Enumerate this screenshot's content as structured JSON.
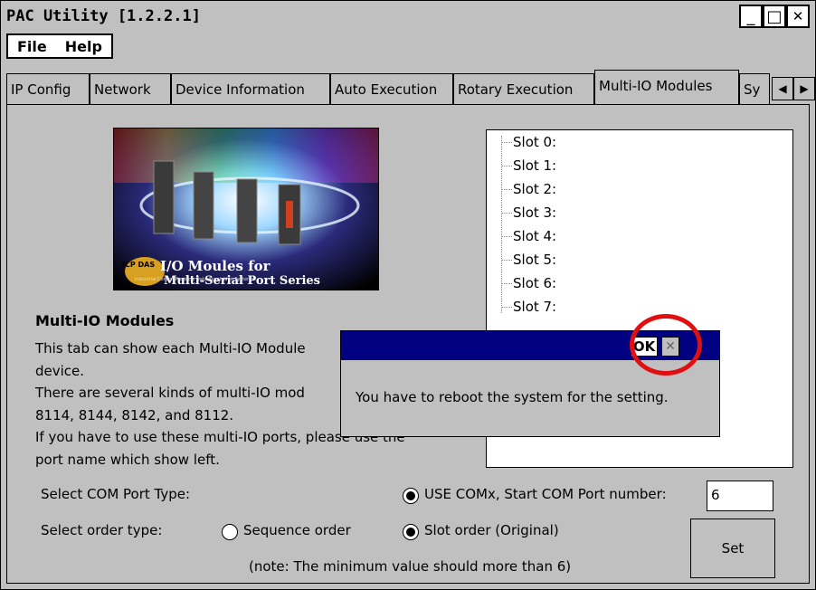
{
  "window": {
    "title": "PAC Utility  [1.2.2.1]",
    "minimize_glyph": "_",
    "maximize_glyph": "□",
    "close_glyph": "✕"
  },
  "menu": {
    "items": [
      "File",
      "Help"
    ]
  },
  "tabs": {
    "items": [
      "IP Config",
      "Network",
      "Device Information",
      "Auto Execution",
      "Rotary Execution",
      "Multi-IO Modules",
      "Sy"
    ],
    "active": "Multi-IO Modules",
    "scroll_left": "◀",
    "scroll_right": "▶"
  },
  "banner": {
    "line1": "I/O Moules for",
    "line2": "Multi-Serial Port Series",
    "tagline": "Industrial Control Products Data Acquisition Systems",
    "logo_text": "ICP DAS"
  },
  "slots": [
    "Slot 0:",
    "Slot 1:",
    "Slot 2:",
    "Slot 3:",
    "Slot 4:",
    "Slot 5:",
    "Slot 6:",
    "Slot 7:"
  ],
  "info": {
    "heading": "Multi-IO Modules",
    "lines": [
      "This tab can show each Multi-IO Module",
      "device.",
      "There are several kinds of multi-IO mod",
      "8114, 8144, 8142, and 8112.",
      "If you have to use these multi-IO ports, please use the",
      "port name which show left."
    ]
  },
  "settings": {
    "com_port_label": "Select COM Port Type:",
    "use_comx_label": "USE COMx, Start COM Port number:",
    "start_com_value": "6",
    "order_label": "Select order type:",
    "sequence_label": "Sequence order",
    "slot_order_label": "Slot order (Original)",
    "note": "(note: The minimum value should more than 6)",
    "set_button": "Set",
    "use_comx_selected": true,
    "order_selected": "Slot order (Original)"
  },
  "dialog": {
    "ok_label": "OK",
    "close_glyph": "✕",
    "message": "You have to reboot the system for the setting."
  },
  "colors": {
    "face": "#c0c0c0",
    "dialog_title": "#000080",
    "highlight": "#e01010"
  }
}
